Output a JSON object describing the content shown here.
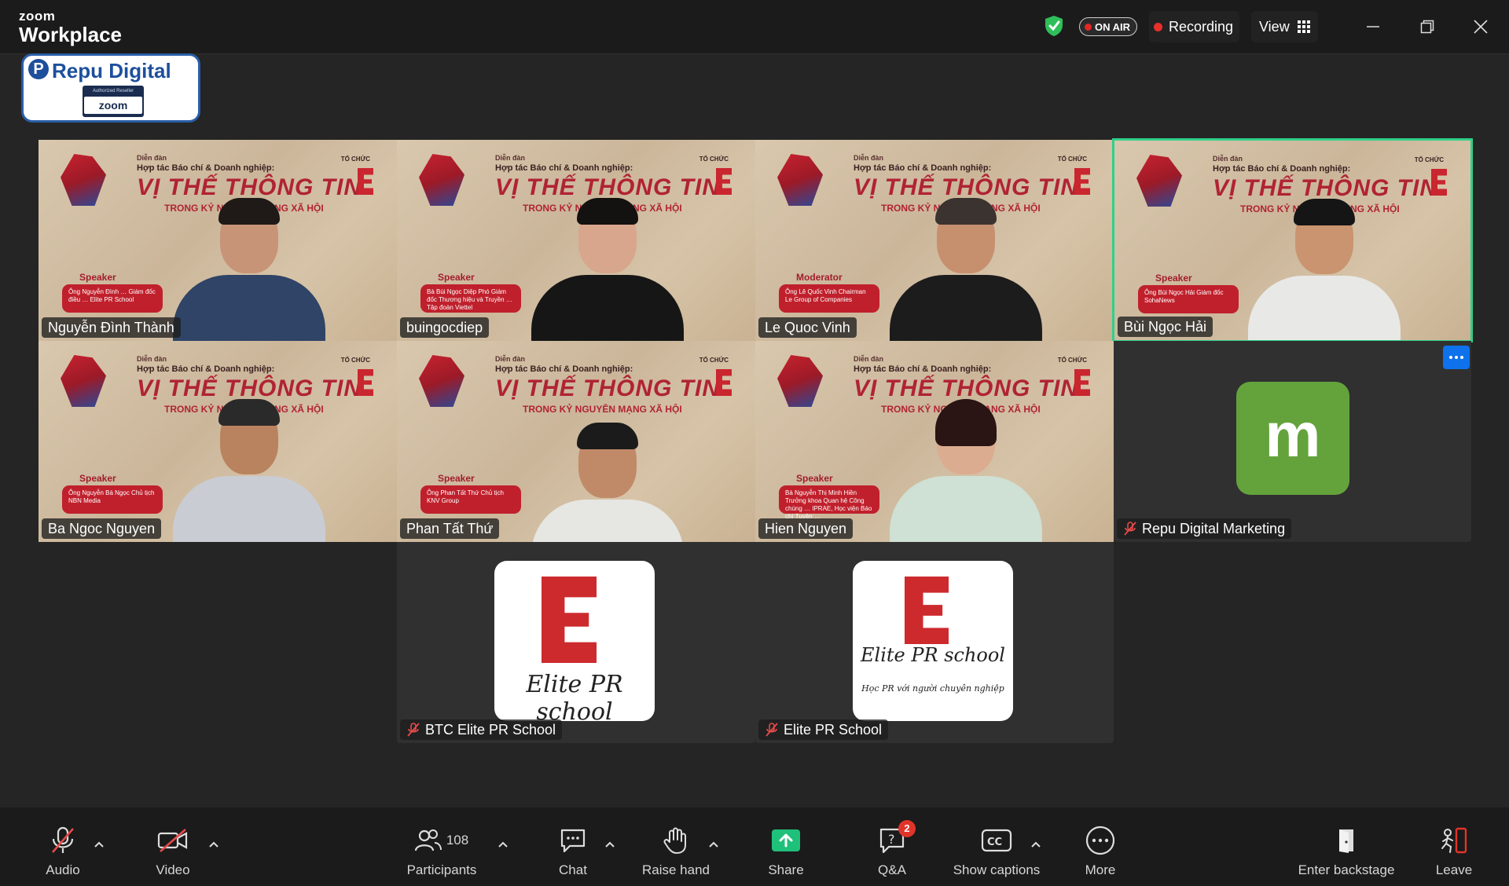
{
  "app": {
    "brand_top": "zoom",
    "brand_bottom": "Workplace"
  },
  "titlebar": {
    "onair_label": "ON AIR",
    "recording_label": "Recording",
    "view_label": "View",
    "shield_color": "#2fbf5a",
    "recording_dot_color": "#e8302b"
  },
  "logo": {
    "name": "Repu Digital",
    "reseller_small": "Authorized Reseller",
    "reseller_brand": "zoom"
  },
  "banner": {
    "forum_small": "Diễn đàn",
    "forum_line": "Hợp tác Báo chí & Doanh nghiệp:",
    "title": "VỊ THẾ THÔNG TIN",
    "subtitle": "TRONG KỶ NGUYÊN MẠNG XÃ HỘI",
    "org": "TỔ CHỨC"
  },
  "participants": [
    {
      "name": "Nguyễn Đình Thành",
      "role": "Speaker",
      "role_text": "Ông Nguyễn Đình … Giám đốc điều … Elite PR School"
    },
    {
      "name": "buingocdiep",
      "role": "Speaker",
      "role_text": "Bà Bùi Ngọc Diệp Phó Giám đốc Thương hiệu và Truyền … Tập đoàn Viettel"
    },
    {
      "name": "Le Quoc Vinh",
      "role": "Moderator",
      "role_text": "Ông Lê Quốc Vinh Chairman Le Group of Companies"
    },
    {
      "name": "Bùi Ngọc Hải",
      "role": "Speaker",
      "role_text": "Ông Bùi Ngọc Hải Giám đốc SohaNews"
    },
    {
      "name": "Ba Ngoc Nguyen",
      "role": "Speaker",
      "role_text": "Ông Nguyễn Bá Ngọc Chủ tịch NBN Media"
    },
    {
      "name": "Phan Tất Thứ",
      "role": "Speaker",
      "role_text": "Ông Phan Tất Thứ Chủ tịch KNV Group"
    },
    {
      "name": "Hien Nguyen",
      "role": "Speaker",
      "role_text": "Bà Nguyễn Thị Minh Hiền Trưởng khoa Quan hệ Công chúng … IPRAE, Học viện Báo chí Tuyên …"
    },
    {
      "name": "Repu Digital Marketing",
      "avatar_letter": "m"
    },
    {
      "name": "BTC Elite PR School",
      "card_script": "Elite PR school"
    },
    {
      "name": "Elite PR School",
      "card_script": "Elite PR school",
      "card_tagline": "Học PR với người chuyên nghiệp"
    }
  ],
  "toolbar": {
    "audio": "Audio",
    "video": "Video",
    "participants": "Participants",
    "participants_count": "108",
    "chat": "Chat",
    "raise_hand": "Raise hand",
    "share": "Share",
    "qa": "Q&A",
    "qa_badge": "2",
    "captions": "Show captions",
    "more": "More",
    "backstage": "Enter backstage",
    "leave": "Leave",
    "share_color": "#1fc07a",
    "leave_color": "#e0342a"
  }
}
